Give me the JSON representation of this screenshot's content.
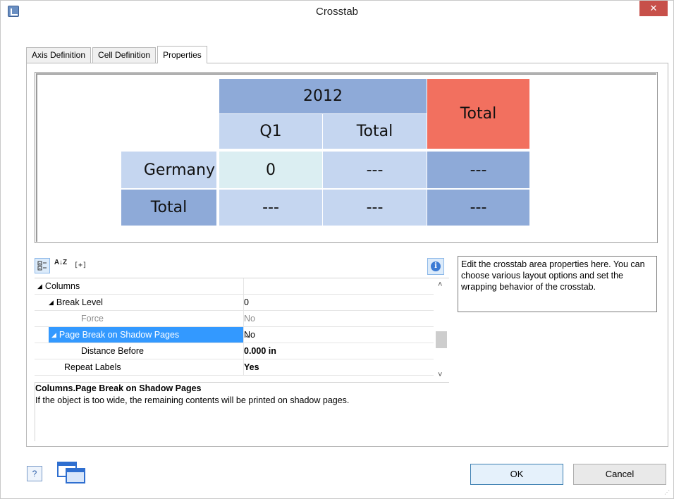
{
  "window": {
    "title": "Crosstab",
    "close_label": "✕"
  },
  "tabs": [
    {
      "label": "Axis Definition",
      "active": false
    },
    {
      "label": "Cell Definition",
      "active": false
    },
    {
      "label": "Properties",
      "active": true
    }
  ],
  "crosstab": {
    "year": "2012",
    "q1": "Q1",
    "col_total": "Total",
    "grand_total": "Total",
    "row_germany": "Germany",
    "row_total": "Total",
    "germany_q1": "0",
    "germany_total": "---",
    "germany_grand": "---",
    "total_q1": "---",
    "total_total": "---",
    "total_grand": "---",
    "colors": {
      "dark": "#8eaad8",
      "light": "#c5d6f0",
      "mint": "#dbeef2",
      "red": "#f2705f"
    }
  },
  "toolbar": {
    "categorized_icon": "categorized-icon",
    "sort_az_label": "A↓Z",
    "expand_label": "[+]",
    "info_label": "i"
  },
  "grid": {
    "rows": [
      {
        "name": "Columns",
        "value": "",
        "tri": "◢"
      },
      {
        "name": "Break Level",
        "value": "0",
        "tri": "◢"
      },
      {
        "name": "Force",
        "value": "No"
      },
      {
        "name": "Page Break on Shadow Pages",
        "value": "No",
        "tri": "◢"
      },
      {
        "name": "Distance Before",
        "value": "0.000 in"
      },
      {
        "name": "Repeat Labels",
        "value": "Yes"
      }
    ],
    "dropdown_arrow": "⌄"
  },
  "description": {
    "title": "Columns.Page Break on Shadow Pages",
    "text": "If the object is too wide, the remaining contents will be printed on shadow pages."
  },
  "help_text": "Edit the crosstab area properties here. You can choose various layout options and set the wrapping behavior of the crosstab.",
  "buttons": {
    "ok": "OK",
    "cancel": "Cancel",
    "help": "?"
  }
}
